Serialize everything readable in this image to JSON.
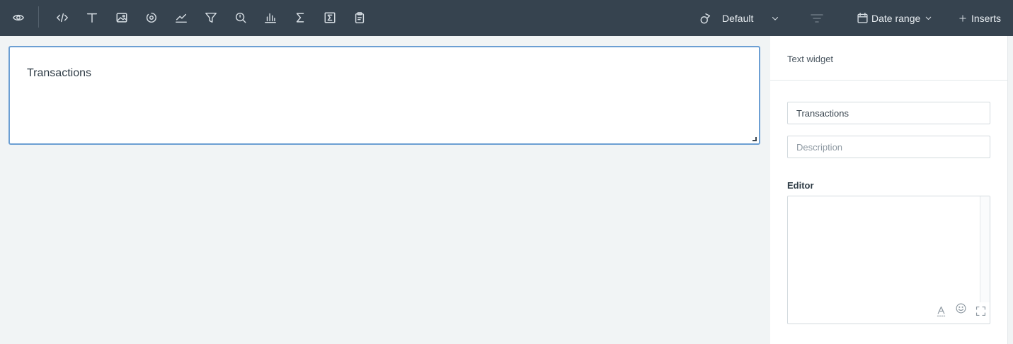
{
  "toolbar": {
    "icons": [
      "eye-icon",
      "code-icon",
      "text-icon",
      "image-icon",
      "gauge-icon",
      "line-chart-icon",
      "filter-icon",
      "search-chart-icon",
      "bar-chart-icon",
      "sigma-icon",
      "sigma-box-icon",
      "clipboard-icon"
    ],
    "theme_label": "Default",
    "date_range_label": "Date range",
    "inserts_label": "Inserts"
  },
  "widget": {
    "title": "Transactions"
  },
  "panel": {
    "header": "Text widget",
    "title_value": "Transactions",
    "description_placeholder": "Description",
    "editor_label": "Editor"
  },
  "colors": {
    "toolbar_bg": "#36434f",
    "canvas_bg": "#f1f4f5",
    "widget_border": "#6c9fd3"
  }
}
